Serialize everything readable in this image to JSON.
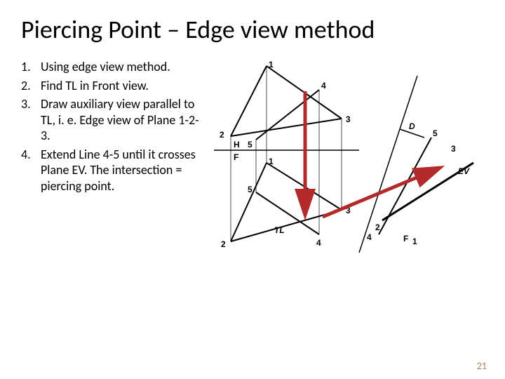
{
  "title": "Piercing Point – Edge view method",
  "steps": [
    "Using edge view method.",
    "Find TL in Front view.",
    "Draw auxiliary view parallel to TL, i. e. Edge view of Plane 1-2-3.",
    "Extend Line 4-5 until it crosses Plane EV. The intersection = piercing point."
  ],
  "labels": {
    "H": "H",
    "F": "F",
    "F2": "F",
    "one_a": "1",
    "one_b": "1",
    "one_c": "1",
    "two_a": "2",
    "two_b": "2",
    "two_c": "2",
    "three_a": "3",
    "three_b": "3",
    "three_c": "3",
    "four_a": "4",
    "four_b": "4",
    "four_c": "4",
    "five_a": "5",
    "five_b": "5",
    "five_c": "5",
    "D": "D",
    "EV": "EV",
    "TL": "TL"
  },
  "page_number": "21"
}
